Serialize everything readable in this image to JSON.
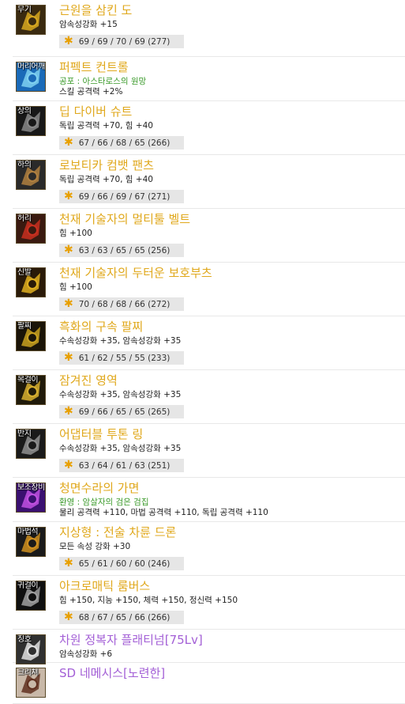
{
  "items": [
    {
      "slot": "무기",
      "name": "근원을 삼킨 도",
      "lines": [
        "암속성강화 +15"
      ],
      "stat": "69 / 69 / 70 / 69 (277)",
      "colors": {
        "a": "#3a2a10",
        "b": "#d8a820"
      }
    },
    {
      "slot": "머리어깨",
      "name": "퍼펙트 컨트롤",
      "set": "공포 : 아스타로스의 원망",
      "lines": [
        "스킬 공격력 +2%"
      ],
      "colors": {
        "a": "#1a6ab8",
        "b": "#7fd0f0"
      }
    },
    {
      "slot": "상의",
      "name": "딥 다이버 슈트",
      "lines": [
        "독립 공격력 +70, 힘 +40"
      ],
      "stat": "67 / 66 / 68 / 65 (266)",
      "colors": {
        "a": "#181818",
        "b": "#888888"
      }
    },
    {
      "slot": "하의",
      "name": "로보티카 컴뱃 팬츠",
      "lines": [
        "독립 공격력 +70, 힘 +40"
      ],
      "stat": "69 / 66 / 69 / 67 (271)",
      "colors": {
        "a": "#2a2a2a",
        "b": "#b08040"
      }
    },
    {
      "slot": "허리",
      "name": "천재 기술자의 멀티툴 벨트",
      "lines": [
        "힘 +100"
      ],
      "stat": "63 / 63 / 65 / 65 (256)",
      "colors": {
        "a": "#3a1a10",
        "b": "#c83020"
      }
    },
    {
      "slot": "신발",
      "name": "천재 기술자의 두터운 보호부츠",
      "lines": [
        "힘 +100"
      ],
      "stat": "70 / 68 / 68 / 66 (272)",
      "colors": {
        "a": "#2a1a08",
        "b": "#e0b020"
      }
    },
    {
      "slot": "팔찌",
      "name": "흑화의 구속 팔찌",
      "lines": [
        "수속성강화 +35, 암속성강화 +35"
      ],
      "stat": "61 / 62 / 55 / 55 (233)",
      "colors": {
        "a": "#1a1408",
        "b": "#c8a020"
      }
    },
    {
      "slot": "목걸이",
      "name": "잠겨진 영역",
      "lines": [
        "수속성강화 +35, 암속성강화 +35"
      ],
      "stat": "69 / 66 / 65 / 65 (265)",
      "colors": {
        "a": "#201a0a",
        "b": "#d8b030"
      }
    },
    {
      "slot": "반지",
      "name": "어댑터블 투톤 링",
      "lines": [
        "수속성강화 +35, 암속성강화 +35"
      ],
      "stat": "63 / 64 / 61 / 63 (251)",
      "colors": {
        "a": "#1a1a1a",
        "b": "#909090"
      }
    },
    {
      "slot": "보조장비",
      "name": "청면수라의 가면",
      "set": "환영 : 암살자의 검은 검집",
      "lines": [
        "물리 공격력 +110, 마법 공격력 +110, 독립 공격력 +110"
      ],
      "colors": {
        "a": "#3a1070",
        "b": "#c050e0"
      }
    },
    {
      "slot": "마법석",
      "name": "지상형 : 전술 차륜 드론",
      "lines": [
        "모든 속성 강화 +30"
      ],
      "stat": "65 / 61 / 60 / 60 (246)",
      "colors": {
        "a": "#1a1a1a",
        "b": "#d09020"
      }
    },
    {
      "slot": "귀걸이",
      "name": "아크로매틱 룸버스",
      "lines": [
        "힘 +150, 지능 +150, 체력 +150, 정신력 +150"
      ],
      "stat": "68 / 67 / 65 / 66 (266)",
      "colors": {
        "a": "#101010",
        "b": "#a0a0a0"
      }
    },
    {
      "slot": "칭호",
      "name": "차원 정복자 플래티넘[75Lv]",
      "lines": [
        "암속성강화 +6"
      ],
      "purple": true,
      "colors": {
        "a": "#303030",
        "b": "#e0e0e0"
      }
    },
    {
      "slot": "크리쳐",
      "name": "SD 네메시스[노련한]",
      "lines": [],
      "purple": true,
      "colors": {
        "a": "#c8b8a8",
        "b": "#603020"
      }
    }
  ]
}
